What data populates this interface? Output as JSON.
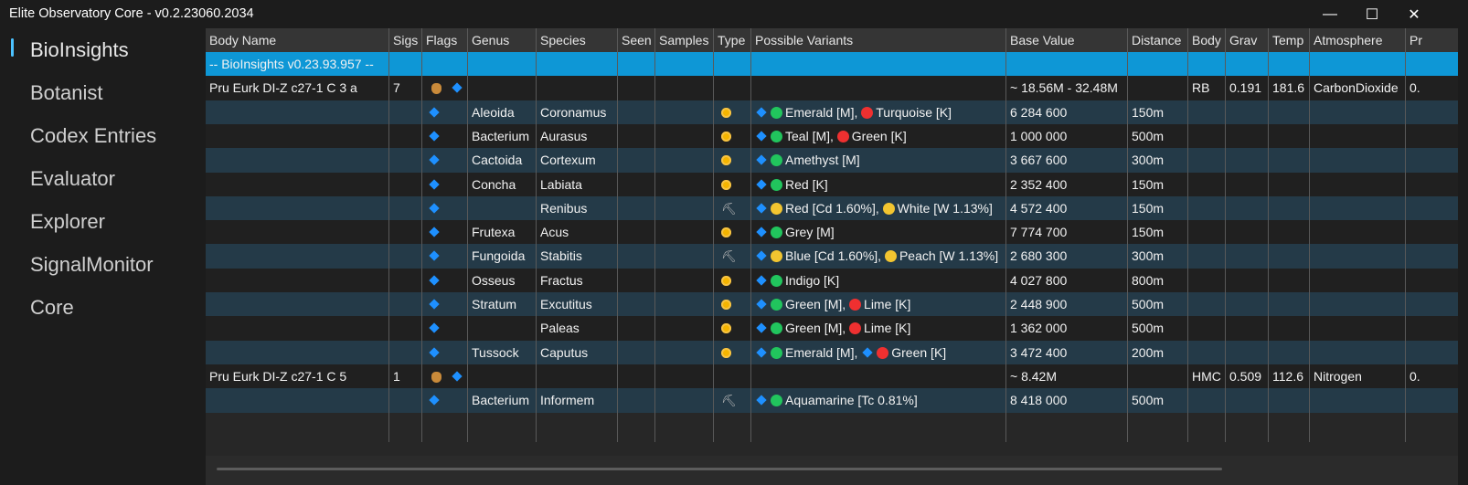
{
  "window": {
    "title": "Elite Observatory Core - v0.2.23060.2034",
    "minimize_icon": "minimize-icon",
    "maximize_icon": "maximize-icon",
    "close_icon": "close-icon"
  },
  "sidebar": {
    "items": [
      {
        "label": "BioInsights",
        "active": true
      },
      {
        "label": "Botanist"
      },
      {
        "label": "Codex Entries"
      },
      {
        "label": "Evaluator"
      },
      {
        "label": "Explorer"
      },
      {
        "label": "SignalMonitor"
      },
      {
        "label": "Core"
      }
    ]
  },
  "table": {
    "columns": [
      "Body Name",
      "Sigs",
      "Flags",
      "Genus",
      "Species",
      "Seen",
      "Samples",
      "Type",
      "Possible Variants",
      "Base Value",
      "Distance",
      "Body",
      "Grav",
      "Temp",
      "Atmosphere",
      "Pr"
    ],
    "group_label": "-- BioInsights v0.23.93.957 --",
    "bodies": [
      {
        "name": "Pru Eurk DI-Z c27-1 C 3 a",
        "sigs": "7",
        "value": "~ 18.56M - 32.48M",
        "body": "RB",
        "grav": "0.191",
        "temp": "181.6",
        "atmosphere": "CarbonDioxide",
        "pr": "0."
      },
      {
        "name": "Pru Eurk DI-Z c27-1 C 5",
        "sigs": "1",
        "value": "~ 8.42M",
        "body": "HMC",
        "grav": "0.509",
        "temp": "112.6",
        "atmosphere": "Nitrogen",
        "pr": "0."
      }
    ],
    "species_rows": [
      {
        "genus": "Aleoida",
        "species": "Coronamus",
        "type": "sun",
        "v1": "Emerald [M],",
        "v1c": "g",
        "v2": "Turquoise [K]",
        "v2c": "r",
        "value": "6 284 600",
        "distance": "150m"
      },
      {
        "genus": "Bacterium",
        "species": "Aurasus",
        "type": "sun",
        "v1": "Teal [M],",
        "v1c": "g",
        "v2": "Green [K]",
        "v2c": "r",
        "value": "1 000 000",
        "distance": "500m"
      },
      {
        "genus": "Cactoida",
        "species": "Cortexum",
        "type": "sun",
        "v1": "Amethyst [M]",
        "v1c": "g",
        "v2": "",
        "v2c": "",
        "value": "3 667 600",
        "distance": "300m"
      },
      {
        "genus": "Concha",
        "species": "Labiata",
        "type": "sun",
        "v1": "Red [K]",
        "v1c": "g",
        "v2": "",
        "v2c": "",
        "value": "2 352 400",
        "distance": "150m"
      },
      {
        "genus": "",
        "species": "Renibus",
        "type": "pick",
        "v1": "Red [Cd 1.60%],",
        "v1c": "y",
        "v2": "White [W 1.13%]",
        "v2c": "y",
        "value": "4 572 400",
        "distance": "150m"
      },
      {
        "genus": "Frutexa",
        "species": "Acus",
        "type": "sun",
        "v1": "Grey [M]",
        "v1c": "g",
        "v2": "",
        "v2c": "",
        "value": "7 774 700",
        "distance": "150m"
      },
      {
        "genus": "Fungoida",
        "species": "Stabitis",
        "type": "pick",
        "v1": "Blue [Cd 1.60%],",
        "v1c": "y",
        "v2": "Peach [W 1.13%]",
        "v2c": "y",
        "value": "2 680 300",
        "distance": "300m"
      },
      {
        "genus": "Osseus",
        "species": "Fractus",
        "type": "sun",
        "v1": "Indigo [K]",
        "v1c": "g",
        "v2": "",
        "v2c": "",
        "value": "4 027 800",
        "distance": "800m"
      },
      {
        "genus": "Stratum",
        "species": "Excutitus",
        "type": "sun",
        "v1": "Green [M],",
        "v1c": "g",
        "v2": "Lime [K]",
        "v2c": "r",
        "value": "2 448 900",
        "distance": "500m"
      },
      {
        "genus": "",
        "species": "Paleas",
        "type": "sun",
        "v1": "Green [M],",
        "v1c": "g",
        "v2": "Lime [K]",
        "v2c": "r",
        "value": "1 362 000",
        "distance": "500m"
      },
      {
        "genus": "Tussock",
        "species": "Caputus",
        "type": "sun",
        "v1": "Emerald [M],",
        "v1c": "g",
        "v2": "Green [K]",
        "v2c": "r",
        "v2diamond": true,
        "value": "3 472 400",
        "distance": "200m"
      },
      {
        "genus": "Bacterium",
        "species": "Informem",
        "type": "pick",
        "v1": "Aquamarine [Tc 0.81%]",
        "v1c": "g",
        "v2": "",
        "v2c": "",
        "value": "8 418 000",
        "distance": "500m"
      }
    ]
  },
  "colors": {
    "accent": "#0e97d6",
    "row_alt": "#243a48",
    "row_dark": "#202020",
    "green": "#21c55d",
    "red": "#ef3030",
    "yellow": "#f2c530",
    "diamond": "#1e90ff"
  }
}
